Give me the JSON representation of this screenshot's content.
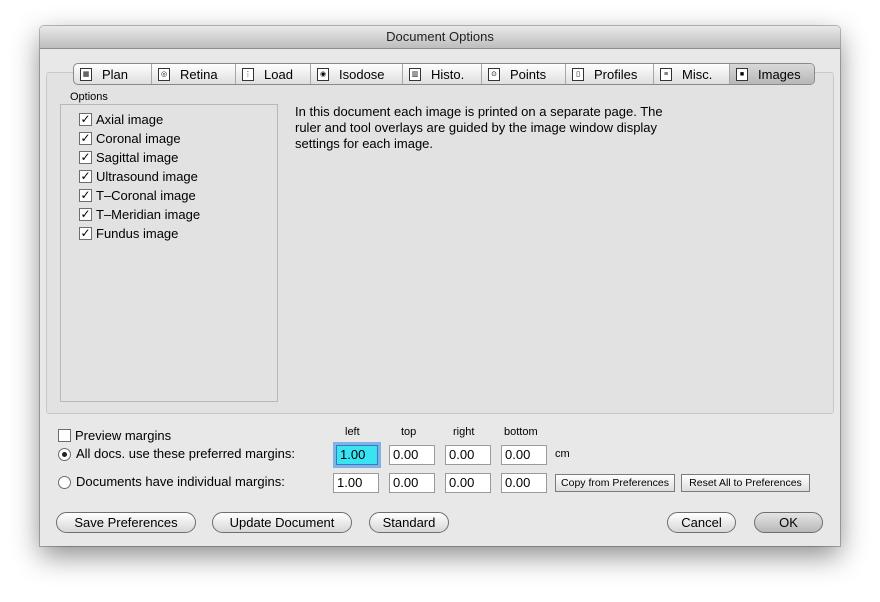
{
  "window": {
    "title": "Document Options"
  },
  "tabs": [
    {
      "label": "Plan",
      "icon": "plan-icon",
      "selected": false
    },
    {
      "label": "Retina",
      "icon": "retina-icon",
      "selected": false
    },
    {
      "label": "Load",
      "icon": "load-icon",
      "selected": false
    },
    {
      "label": "Isodose",
      "icon": "isodose-icon",
      "selected": false
    },
    {
      "label": "Histo.",
      "icon": "histo-icon",
      "selected": false
    },
    {
      "label": "Points",
      "icon": "points-icon",
      "selected": false
    },
    {
      "label": "Profiles",
      "icon": "profiles-icon",
      "selected": false
    },
    {
      "label": "Misc.",
      "icon": "misc-icon",
      "selected": false
    },
    {
      "label": "Images",
      "icon": "images-icon",
      "selected": true
    }
  ],
  "options": {
    "label": "Options",
    "items": [
      {
        "label": "Axial image",
        "checked": true
      },
      {
        "label": "Coronal image",
        "checked": true
      },
      {
        "label": "Sagittal image",
        "checked": true
      },
      {
        "label": "Ultrasound image",
        "checked": true
      },
      {
        "label": "T–Coronal image",
        "checked": true
      },
      {
        "label": "T–Meridian image",
        "checked": true
      },
      {
        "label": "Fundus image",
        "checked": true
      }
    ]
  },
  "description": {
    "line1": "In this document each image is printed on a separate page. The",
    "line2": "ruler and tool overlays are guided by the image window display",
    "line3": "settings for each image."
  },
  "margins": {
    "preview_label": "Preview margins",
    "preview_checked": false,
    "columns": {
      "left": "left",
      "top": "top",
      "right": "right",
      "bottom": "bottom"
    },
    "preferred": {
      "label": "All docs. use these preferred margins:",
      "selected": true,
      "left": "1.00",
      "top": "0.00",
      "right": "0.00",
      "bottom": "0.00",
      "unit": "cm"
    },
    "individual": {
      "label": "Documents have individual margins:",
      "selected": false,
      "left": "1.00",
      "top": "0.00",
      "right": "0.00",
      "bottom": "0.00"
    },
    "copy_button": "Copy from Preferences",
    "reset_button": "Reset All to Preferences"
  },
  "buttons": {
    "save_preferences": "Save Preferences",
    "update_document": "Update Document",
    "standard": "Standard",
    "cancel": "Cancel",
    "ok": "OK"
  }
}
